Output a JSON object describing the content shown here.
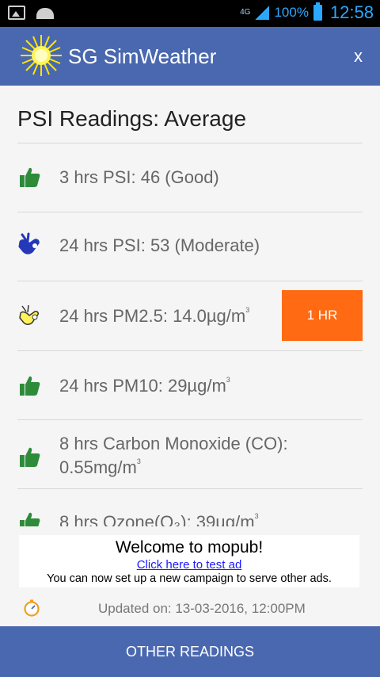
{
  "status_bar": {
    "network": "4G",
    "battery": "100%",
    "time": "12:58"
  },
  "app_bar": {
    "title": "SG SimWeather",
    "close_label": "x"
  },
  "main": {
    "title": "PSI Readings: Average",
    "readings": [
      {
        "text": "3 hrs PSI: 46 (Good)",
        "sup": "",
        "line2": "",
        "icon": "thumbs-up-green-icon"
      },
      {
        "text": "24 hrs PSI: 53 (Moderate)",
        "sup": "",
        "line2": "",
        "icon": "ok-hand-blue-icon"
      },
      {
        "text": "24 hrs PM2.5: 14.0µg/m",
        "sup": "3",
        "line2": "",
        "icon": "ok-hand-yellow-icon"
      },
      {
        "text": "24 hrs PM10: 29µg/m",
        "sup": "3",
        "line2": "",
        "icon": "thumbs-up-green-icon"
      },
      {
        "text": "8 hrs Carbon Monoxide (CO):",
        "sup": "",
        "line2": "0.55mg/m",
        "line2_sup": "3",
        "icon": "thumbs-up-green-icon"
      },
      {
        "text": "8 hrs Ozone(O₃): 39µg/m",
        "sup": "3",
        "line2": "",
        "icon": "thumbs-up-green-icon"
      }
    ],
    "hr_button": "1 HR"
  },
  "ad": {
    "title": "Welcome to mopub!",
    "link": "Click here to test ad",
    "description": "You can now set up a new campaign to serve other ads."
  },
  "updated": {
    "text": "Updated on: 13-03-2016, 12:00PM",
    "icon": "stopwatch-icon"
  },
  "bottom_bar": {
    "label": "OTHER READINGS"
  },
  "colors": {
    "app_bar": "#4a68b0",
    "accent_button": "#ff6a13",
    "good": "#2e8b3a",
    "moderate": "#2438b8",
    "status_blue": "#2aa8ff"
  }
}
